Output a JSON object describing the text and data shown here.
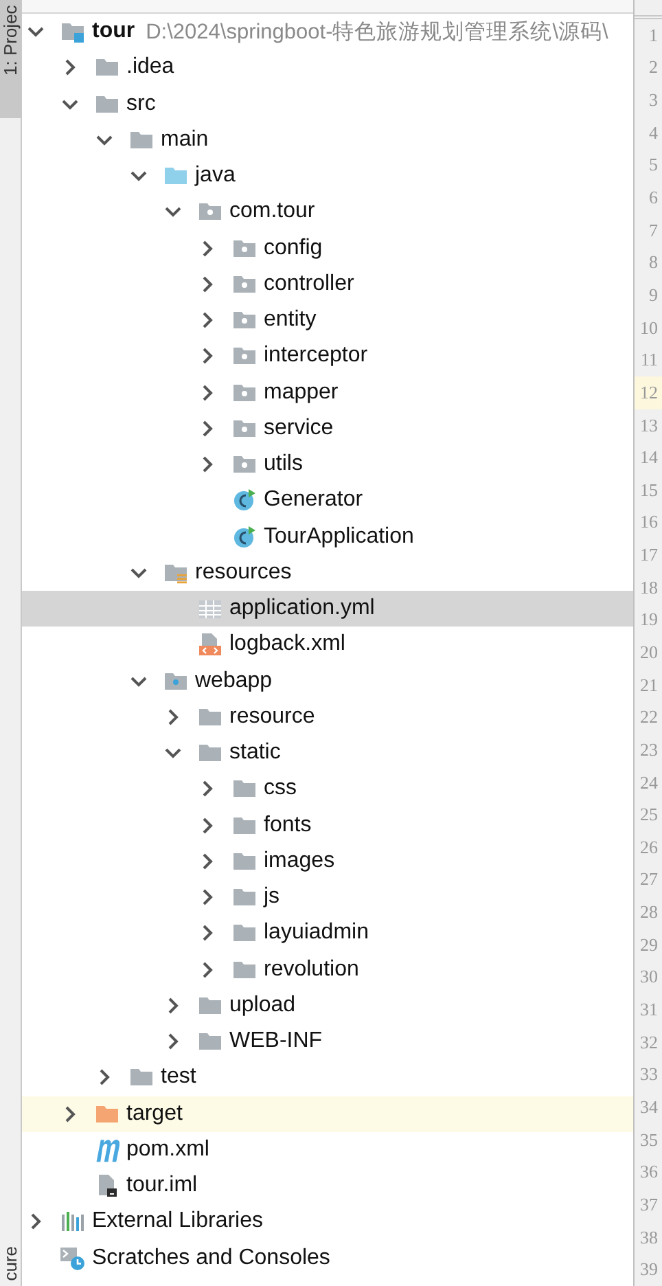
{
  "left_strip": {
    "top_tab": {
      "label": "1: Projec",
      "selected": true
    },
    "bottom_tab": {
      "label": "cure"
    }
  },
  "tree": [
    {
      "kind": "module",
      "name": "tour",
      "path": "D:\\2024\\springboot-特色旅游规划管理系统\\源码\\",
      "expanded": true,
      "children": [
        {
          "kind": "folder",
          "name": ".idea",
          "expanded": false
        },
        {
          "kind": "folder",
          "name": "src",
          "expanded": true,
          "children": [
            {
              "kind": "folder",
              "name": "main",
              "expanded": true,
              "children": [
                {
                  "kind": "source",
                  "name": "java",
                  "expanded": true,
                  "children": [
                    {
                      "kind": "package",
                      "name": "com.tour",
                      "expanded": true,
                      "children": [
                        {
                          "kind": "package",
                          "name": "config",
                          "expanded": false
                        },
                        {
                          "kind": "package",
                          "name": "controller",
                          "expanded": false
                        },
                        {
                          "kind": "package",
                          "name": "entity",
                          "expanded": false
                        },
                        {
                          "kind": "package",
                          "name": "interceptor",
                          "expanded": false
                        },
                        {
                          "kind": "package",
                          "name": "mapper",
                          "expanded": false
                        },
                        {
                          "kind": "package",
                          "name": "service",
                          "expanded": false
                        },
                        {
                          "kind": "package",
                          "name": "utils",
                          "expanded": false
                        },
                        {
                          "kind": "class",
                          "name": "Generator"
                        },
                        {
                          "kind": "class",
                          "name": "TourApplication"
                        }
                      ]
                    }
                  ]
                },
                {
                  "kind": "resources",
                  "name": "resources",
                  "expanded": true,
                  "children": [
                    {
                      "kind": "yml",
                      "name": "application.yml",
                      "selected": true
                    },
                    {
                      "kind": "xml",
                      "name": "logback.xml",
                      "selected": false
                    }
                  ]
                },
                {
                  "kind": "web",
                  "name": "webapp",
                  "expanded": true,
                  "children": [
                    {
                      "kind": "folder",
                      "name": "resource",
                      "expanded": false
                    },
                    {
                      "kind": "folder",
                      "name": "static",
                      "expanded": true,
                      "children": [
                        {
                          "kind": "folder",
                          "name": "css",
                          "expanded": false
                        },
                        {
                          "kind": "folder",
                          "name": "fonts",
                          "expanded": false
                        },
                        {
                          "kind": "folder",
                          "name": "images",
                          "expanded": false
                        },
                        {
                          "kind": "folder",
                          "name": "js",
                          "expanded": false
                        },
                        {
                          "kind": "folder",
                          "name": "layuiadmin",
                          "expanded": false
                        },
                        {
                          "kind": "folder",
                          "name": "revolution",
                          "expanded": false
                        }
                      ]
                    },
                    {
                      "kind": "folder",
                      "name": "upload",
                      "expanded": false
                    },
                    {
                      "kind": "folder",
                      "name": "WEB-INF",
                      "expanded": false
                    }
                  ]
                }
              ]
            },
            {
              "kind": "folder",
              "name": "test",
              "expanded": false
            }
          ]
        },
        {
          "kind": "excluded",
          "name": "target",
          "expanded": false
        },
        {
          "kind": "maven",
          "name": "pom.xml"
        },
        {
          "kind": "iml",
          "name": "tour.iml"
        }
      ]
    },
    {
      "kind": "libraries",
      "name": "External Libraries",
      "expanded": false
    },
    {
      "kind": "scratches",
      "name": "Scratches and Consoles"
    }
  ],
  "gutter": [
    {
      "number": "1",
      "current": false
    },
    {
      "number": "2",
      "current": false
    },
    {
      "number": "3",
      "current": false
    },
    {
      "number": "4",
      "current": false
    },
    {
      "number": "5",
      "current": false
    },
    {
      "number": "6",
      "current": false
    },
    {
      "number": "7",
      "current": false
    },
    {
      "number": "8",
      "current": false
    },
    {
      "number": "9",
      "current": false
    },
    {
      "number": "10",
      "current": false
    },
    {
      "number": "11",
      "current": false
    },
    {
      "number": "12",
      "current": true
    },
    {
      "number": "13",
      "current": false
    },
    {
      "number": "14",
      "current": false
    },
    {
      "number": "15",
      "current": false
    },
    {
      "number": "16",
      "current": false
    },
    {
      "number": "17",
      "current": false
    },
    {
      "number": "18",
      "current": false
    },
    {
      "number": "19",
      "current": false
    },
    {
      "number": "20",
      "current": false
    },
    {
      "number": "21",
      "current": false
    },
    {
      "number": "22",
      "current": false
    },
    {
      "number": "23",
      "current": false
    },
    {
      "number": "24",
      "current": false
    },
    {
      "number": "25",
      "current": false
    },
    {
      "number": "26",
      "current": false
    },
    {
      "number": "27",
      "current": false
    },
    {
      "number": "28",
      "current": false
    },
    {
      "number": "29",
      "current": false
    },
    {
      "number": "30",
      "current": false
    },
    {
      "number": "31",
      "current": false
    },
    {
      "number": "32",
      "current": false
    },
    {
      "number": "33",
      "current": false
    },
    {
      "number": "34",
      "current": false
    },
    {
      "number": "35",
      "current": false
    },
    {
      "number": "36",
      "current": false
    },
    {
      "number": "37",
      "current": false
    },
    {
      "number": "38",
      "current": false
    },
    {
      "number": "39",
      "current": false
    }
  ]
}
